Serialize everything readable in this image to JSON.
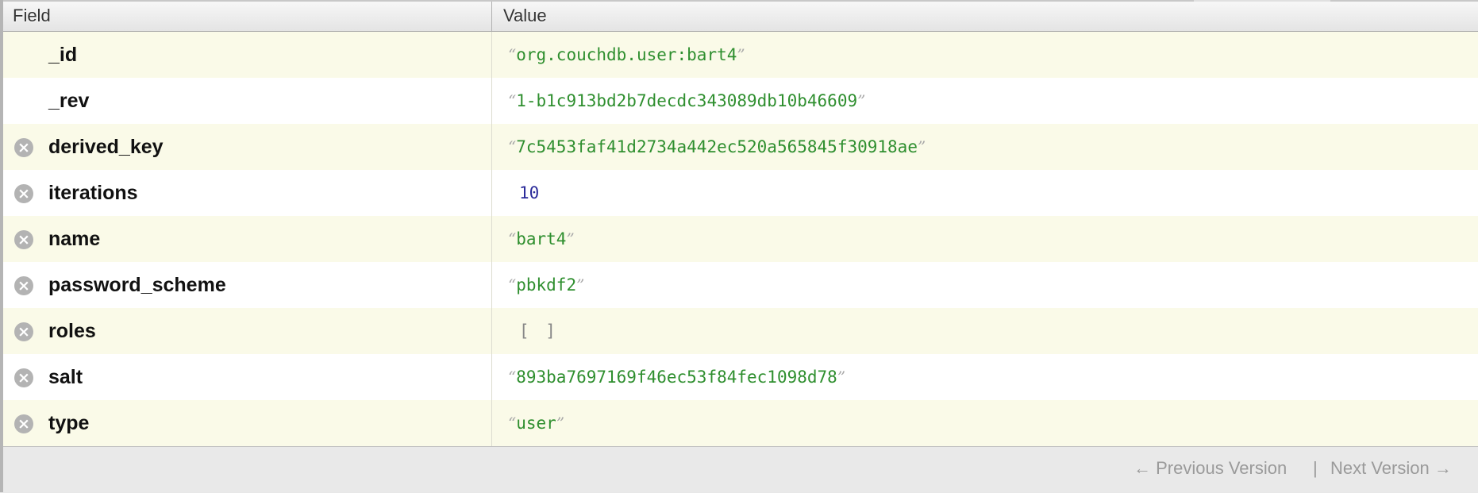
{
  "header": {
    "field": "Field",
    "value": "Value"
  },
  "rows": [
    {
      "field": "_id",
      "deletable": false,
      "value": "org.couchdb.user:bart4",
      "kind": "string"
    },
    {
      "field": "_rev",
      "deletable": false,
      "value": "1-b1c913bd2b7decdc343089db10b46609",
      "kind": "string"
    },
    {
      "field": "derived_key",
      "deletable": true,
      "value": "7c5453faf41d2734a442ec520a565845f30918ae",
      "kind": "string"
    },
    {
      "field": "iterations",
      "deletable": true,
      "value": "10",
      "kind": "number"
    },
    {
      "field": "name",
      "deletable": true,
      "value": "bart4",
      "kind": "string"
    },
    {
      "field": "password_scheme",
      "deletable": true,
      "value": "pbkdf2",
      "kind": "string"
    },
    {
      "field": "roles",
      "deletable": true,
      "value": "[ ]",
      "kind": "array"
    },
    {
      "field": "salt",
      "deletable": true,
      "value": "893ba7697169f46ec53f84fec1098d78",
      "kind": "string"
    },
    {
      "field": "type",
      "deletable": true,
      "value": "user",
      "kind": "string"
    }
  ],
  "footer": {
    "previous": "← Previous Version",
    "separator": "|",
    "next": "Next Version →"
  },
  "icons": {
    "delete": "delete-icon"
  },
  "colors": {
    "string": "#2f8f2f",
    "number": "#2b2b9a",
    "odd_row": "#fafae8"
  }
}
